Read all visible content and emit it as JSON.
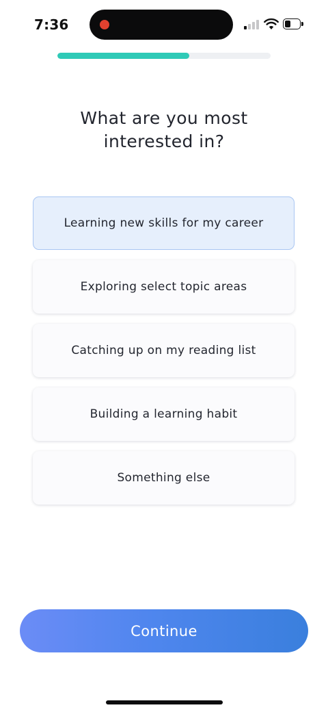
{
  "status_bar": {
    "time": "7:36",
    "icons": [
      "recording-dot-icon",
      "cellular-signal-icon",
      "wifi-icon",
      "battery-icon"
    ],
    "signal_bars_active": 1,
    "battery_level": 0.3
  },
  "progress": {
    "fraction": 0.62,
    "color": "#2fcab7"
  },
  "question": "What are you most interested in?",
  "options": [
    {
      "label": "Learning new skills for my career",
      "selected": true
    },
    {
      "label": "Exploring select topic areas",
      "selected": false
    },
    {
      "label": "Catching up on my reading list",
      "selected": false
    },
    {
      "label": "Building a learning habit",
      "selected": false
    },
    {
      "label": "Something else",
      "selected": false
    }
  ],
  "continue_label": "Continue",
  "colors": {
    "accent": "#4f86ee",
    "selected_bg": "#e6effc",
    "recording": "#e2412f"
  }
}
